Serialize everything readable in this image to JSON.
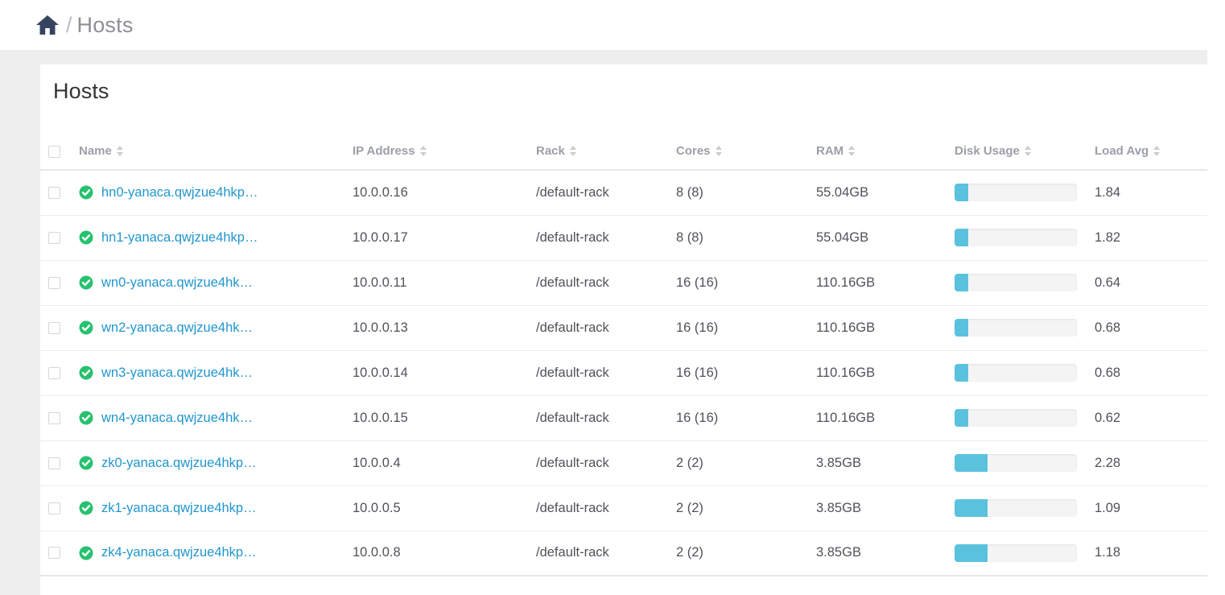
{
  "breadcrumb": {
    "home_icon": "home-icon",
    "separator": "/",
    "current": "Hosts"
  },
  "panel": {
    "title": "Hosts"
  },
  "colors": {
    "link": "#2196cf",
    "status_ok": "#27c16f",
    "progress_fill": "#5bc2de",
    "progress_track": "#f4f4f4",
    "header_text": "#9b9fa6",
    "page_bg": "#eeeeee"
  },
  "table": {
    "select_all_checkbox": false,
    "columns": [
      {
        "key": "name",
        "label": "Name",
        "sortable": true
      },
      {
        "key": "ip",
        "label": "IP Address",
        "sortable": true
      },
      {
        "key": "rack",
        "label": "Rack",
        "sortable": true
      },
      {
        "key": "cores",
        "label": "Cores",
        "sortable": true
      },
      {
        "key": "ram",
        "label": "RAM",
        "sortable": true
      },
      {
        "key": "disk",
        "label": "Disk Usage",
        "sortable": true
      },
      {
        "key": "load",
        "label": "Load Avg",
        "sortable": true
      }
    ],
    "rows": [
      {
        "selected": false,
        "status": "healthy",
        "name": "hn0-yanaca.qwjzue4hkp…",
        "ip": "10.0.0.16",
        "rack": "/default-rack",
        "cores": "8 (8)",
        "ram": "55.04GB",
        "disk_percent": 11,
        "load": "1.84"
      },
      {
        "selected": false,
        "status": "healthy",
        "name": "hn1-yanaca.qwjzue4hkp…",
        "ip": "10.0.0.17",
        "rack": "/default-rack",
        "cores": "8 (8)",
        "ram": "55.04GB",
        "disk_percent": 11,
        "load": "1.82"
      },
      {
        "selected": false,
        "status": "healthy",
        "name": "wn0-yanaca.qwjzue4hk…",
        "ip": "10.0.0.11",
        "rack": "/default-rack",
        "cores": "16 (16)",
        "ram": "110.16GB",
        "disk_percent": 11,
        "load": "0.64"
      },
      {
        "selected": false,
        "status": "healthy",
        "name": "wn2-yanaca.qwjzue4hk…",
        "ip": "10.0.0.13",
        "rack": "/default-rack",
        "cores": "16 (16)",
        "ram": "110.16GB",
        "disk_percent": 11,
        "load": "0.68"
      },
      {
        "selected": false,
        "status": "healthy",
        "name": "wn3-yanaca.qwjzue4hk…",
        "ip": "10.0.0.14",
        "rack": "/default-rack",
        "cores": "16 (16)",
        "ram": "110.16GB",
        "disk_percent": 11,
        "load": "0.68"
      },
      {
        "selected": false,
        "status": "healthy",
        "name": "wn4-yanaca.qwjzue4hk…",
        "ip": "10.0.0.15",
        "rack": "/default-rack",
        "cores": "16 (16)",
        "ram": "110.16GB",
        "disk_percent": 11,
        "load": "0.62"
      },
      {
        "selected": false,
        "status": "healthy",
        "name": "zk0-yanaca.qwjzue4hkp…",
        "ip": "10.0.0.4",
        "rack": "/default-rack",
        "cores": "2 (2)",
        "ram": "3.85GB",
        "disk_percent": 27,
        "load": "2.28"
      },
      {
        "selected": false,
        "status": "healthy",
        "name": "zk1-yanaca.qwjzue4hkp…",
        "ip": "10.0.0.5",
        "rack": "/default-rack",
        "cores": "2 (2)",
        "ram": "3.85GB",
        "disk_percent": 27,
        "load": "1.09"
      },
      {
        "selected": false,
        "status": "healthy",
        "name": "zk4-yanaca.qwjzue4hkp…",
        "ip": "10.0.0.8",
        "rack": "/default-rack",
        "cores": "2 (2)",
        "ram": "3.85GB",
        "disk_percent": 27,
        "load": "1.18"
      }
    ]
  }
}
